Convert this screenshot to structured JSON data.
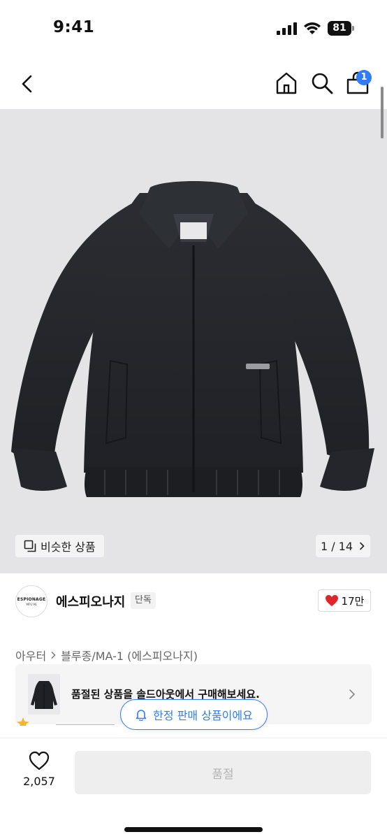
{
  "status_bar": {
    "time": "9:41",
    "battery": "81"
  },
  "nav": {
    "cart_count": "1",
    "icons": [
      "back-icon",
      "home-icon",
      "search-icon",
      "cart-icon"
    ]
  },
  "gallery": {
    "similar_label": "비슷한 상품",
    "pager": "1 / 14",
    "current_page": 1,
    "total_pages": 14
  },
  "brand": {
    "name": "에스피오나지",
    "tag": "단독",
    "logo_text": "ESPIONAGE",
    "logo_sub": "MFG'96",
    "likes": "17만"
  },
  "breadcrumb": {
    "level1": "아우터",
    "level2": "블루종/MA-1 (에스피오나지)"
  },
  "soldout_banner": {
    "text": "품절된 상품을 솔드아웃에서 구매해보세요."
  },
  "toast": {
    "text": "한정 판매 상품이에요"
  },
  "bottom": {
    "wish_count": "2,057",
    "buy_label": "품절"
  },
  "colors": {
    "accent": "#2f7cf6",
    "heart": "#e0262a",
    "image_bg": "#e4e4e6"
  }
}
